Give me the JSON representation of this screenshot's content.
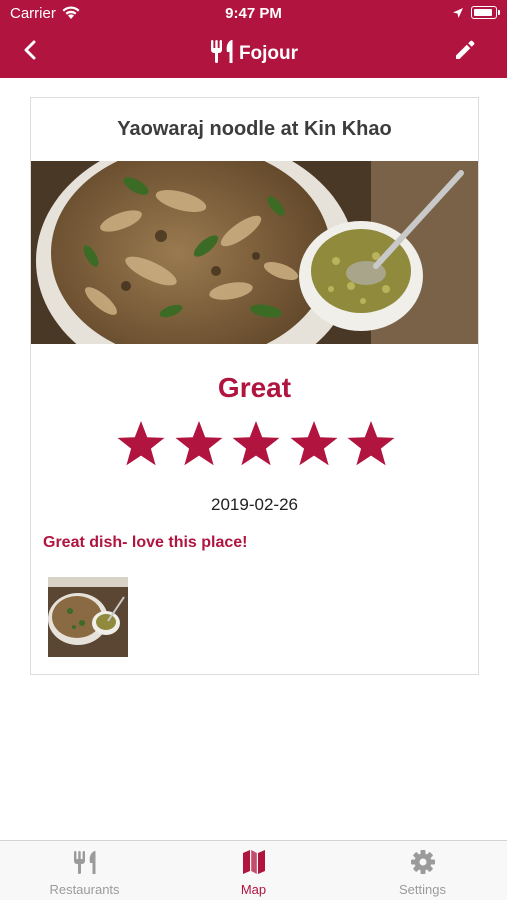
{
  "colors": {
    "accent": "#b0143f",
    "tab_inactive": "#9b9b9b",
    "header_bg": "#b0143f"
  },
  "status_bar": {
    "carrier": "Carrier",
    "time": "9:47 PM"
  },
  "nav": {
    "title": "Fojour",
    "title_icon": "fork-knife-icon",
    "back_icon": "chevron-left-icon",
    "edit_icon": "pencil-icon"
  },
  "review": {
    "dish_title": "Yaowaraj noodle at Kin Khao",
    "rating_word": "Great",
    "stars": 5,
    "stars_max": 5,
    "date": "2019-02-26",
    "comment": "Great dish- love this place!"
  },
  "tabs": [
    {
      "label": "Restaurants",
      "icon": "fork-knife-icon",
      "active": false
    },
    {
      "label": "Map",
      "icon": "map-icon",
      "active": true
    },
    {
      "label": "Settings",
      "icon": "gear-icon",
      "active": false
    }
  ]
}
